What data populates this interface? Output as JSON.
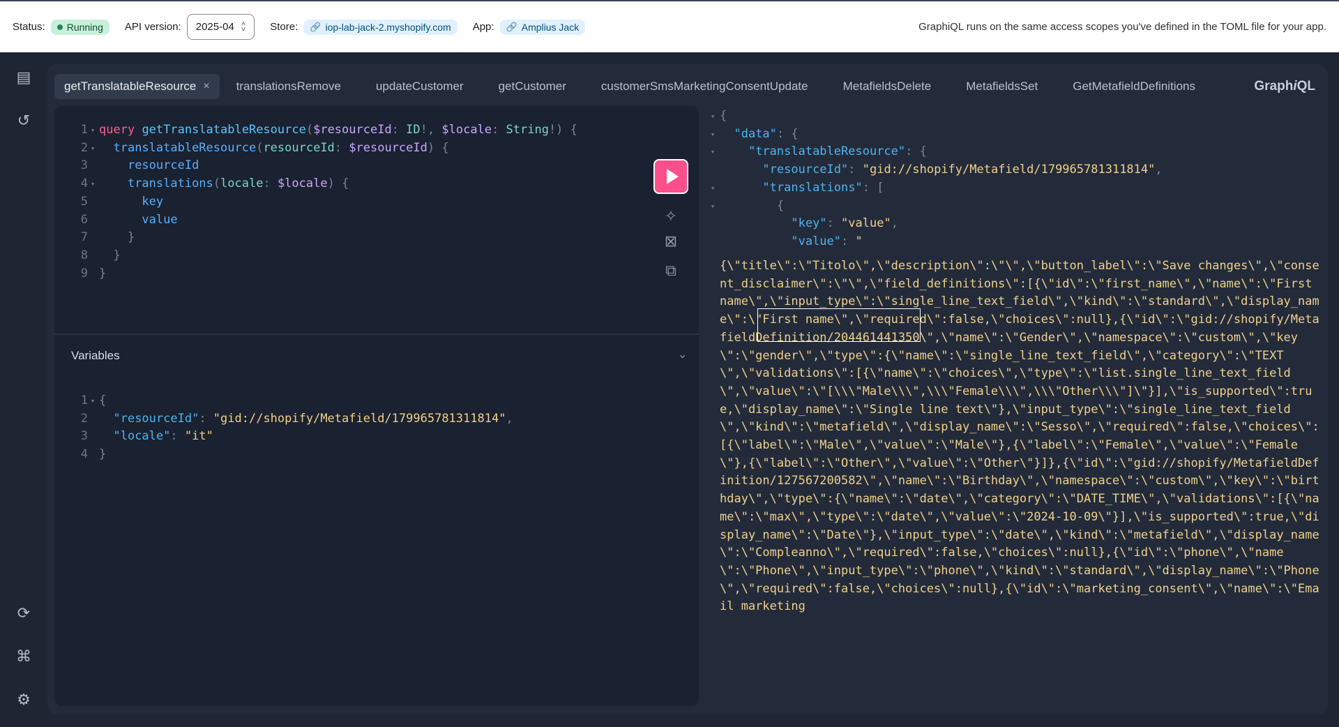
{
  "topbar": {
    "status_label": "Status:",
    "status_value": "Running",
    "api_label": "API version:",
    "api_value": "2025-04",
    "store_label": "Store:",
    "store_value": "iop-lab-jack-2.myshopify.com",
    "app_label": "App:",
    "app_value": "Amplius Jack",
    "note": "GraphiQL runs on the same access scopes you've defined in the TOML file for your app."
  },
  "rail": {
    "icons": [
      "docs-icon",
      "history-icon",
      "refetch-schema-icon",
      "shortcuts-icon",
      "settings-icon"
    ]
  },
  "tabs": [
    {
      "label": "getTranslatableResource",
      "active": true
    },
    {
      "label": "translationsRemove"
    },
    {
      "label": "updateCustomer"
    },
    {
      "label": "getCustomer"
    },
    {
      "label": "customerSmsMarketingConsentUpdate"
    },
    {
      "label": "MetafieldsDelete"
    },
    {
      "label": "MetafieldsSet"
    },
    {
      "label": "GetMetafieldDefinitions"
    }
  ],
  "brand": {
    "prefix": "Graph",
    "italic": "i",
    "suffix": "QL"
  },
  "query": {
    "lines": [
      "query getTranslatableResource($resourceId: ID!, $locale: String!) {",
      "  translatableResource(resourceId: $resourceId) {",
      "    resourceId",
      "    translations(locale: $locale) {",
      "      key",
      "      value",
      "    }",
      "  }",
      "}"
    ]
  },
  "variables": {
    "heading": "Variables",
    "resourceId_key": "\"resourceId\"",
    "resourceId_value": "\"gid://shopify/Metafield/179965781311814\"",
    "locale_key": "\"locale\"",
    "locale_value": "\"it\""
  },
  "response": {
    "data_key": "\"data\"",
    "tr_key": "\"translatableResource\"",
    "rid_key": "\"resourceId\"",
    "rid_value": "\"gid://shopify/Metafield/179965781311814\"",
    "translations_key": "\"translations\"",
    "key_key": "\"key\"",
    "key_value": "\"value\"",
    "value_key": "\"value\"",
    "value_open": "\"",
    "value_text": "{\\\"title\\\":\\\"Titolo\\\",\\\"description\\\":\\\"\\\",\\\"button_label\\\":\\\"Save changes\\\",\\\"consent_disclaimer\\\":\\\"\\\",\\\"field_definitions\\\":[{\\\"id\\\":\\\"first_name\\\",\\\"name\\\":\\\"First name\\\",\\\"input_type\\\":\\\"single_line_text_field\\\",\\\"kind\\\":\\\"standard\\\",\\\"display_name\\\":\\\"First name\\\",\\\"required\\\":false,\\\"choices\\\":null},{\\\"id\\\":\\\"gid://shopify/MetafieldDefinition/204461441350\\\",\\\"name\\\":\\\"Gender\\\",\\\"namespace\\\":\\\"custom\\\",\\\"key\\\":\\\"gender\\\",\\\"type\\\":{\\\"name\\\":\\\"single_line_text_field\\\",\\\"category\\\":\\\"TEXT\\\",\\\"validations\\\":[{\\\"name\\\":\\\"choices\\\",\\\"type\\\":\\\"list.single_line_text_field\\\",\\\"value\\\":\\\"[\\\\\\\"Male\\\\\\\",\\\\\\\"Female\\\\\\\",\\\\\\\"Other\\\\\\\"]\\\"}],\\\"is_supported\\\":true,\\\"display_name\\\":\\\"Single line text\\\"},\\\"input_type\\\":\\\"single_line_text_field\\\",\\\"kind\\\":\\\"metafield\\\",\\\"display_name\\\":\\\"Sesso\\\",\\\"required\\\":false,\\\"choices\\\":[{\\\"label\\\":\\\"Male\\\",\\\"value\\\":\\\"Male\\\"},{\\\"label\\\":\\\"Female\\\",\\\"value\\\":\\\"Female\\\"},{\\\"label\\\":\\\"Other\\\",\\\"value\\\":\\\"Other\\\"}]},{\\\"id\\\":\\\"gid://shopify/MetafieldDefinition/127567200582\\\",\\\"name\\\":\\\"Birthday\\\",\\\"namespace\\\":\\\"custom\\\",\\\"key\\\":\\\"birthday\\\",\\\"type\\\":{\\\"name\\\":\\\"date\\\",\\\"category\\\":\\\"DATE_TIME\\\",\\\"validations\\\":[{\\\"name\\\":\\\"max\\\",\\\"type\\\":\\\"date\\\",\\\"value\\\":\\\"2024-10-09\\\"}],\\\"is_supported\\\":true,\\\"display_name\\\":\\\"Date\\\"},\\\"input_type\\\":\\\"date\\\",\\\"kind\\\":\\\"metafield\\\",\\\"display_name\\\":\\\"Compleanno\\\",\\\"required\\\":false,\\\"choices\\\":null},{\\\"id\\\":\\\"phone\\\",\\\"name\\\":\\\"Phone\\\",\\\"input_type\\\":\\\"phone\\\",\\\"kind\\\":\\\"standard\\\",\\\"display_name\\\":\\\"Phone\\\",\\\"required\\\":false,\\\"choices\\\":null},{\\\"id\\\":\\\"marketing_consent\\\",\\\"name\\\":\\\"Email marketing"
  },
  "colors": {
    "accent": "#ff4f8b",
    "panel": "#232b3a",
    "editor": "#1a2130",
    "string": "#f0d08a",
    "keyword": "#ff5d8f"
  }
}
